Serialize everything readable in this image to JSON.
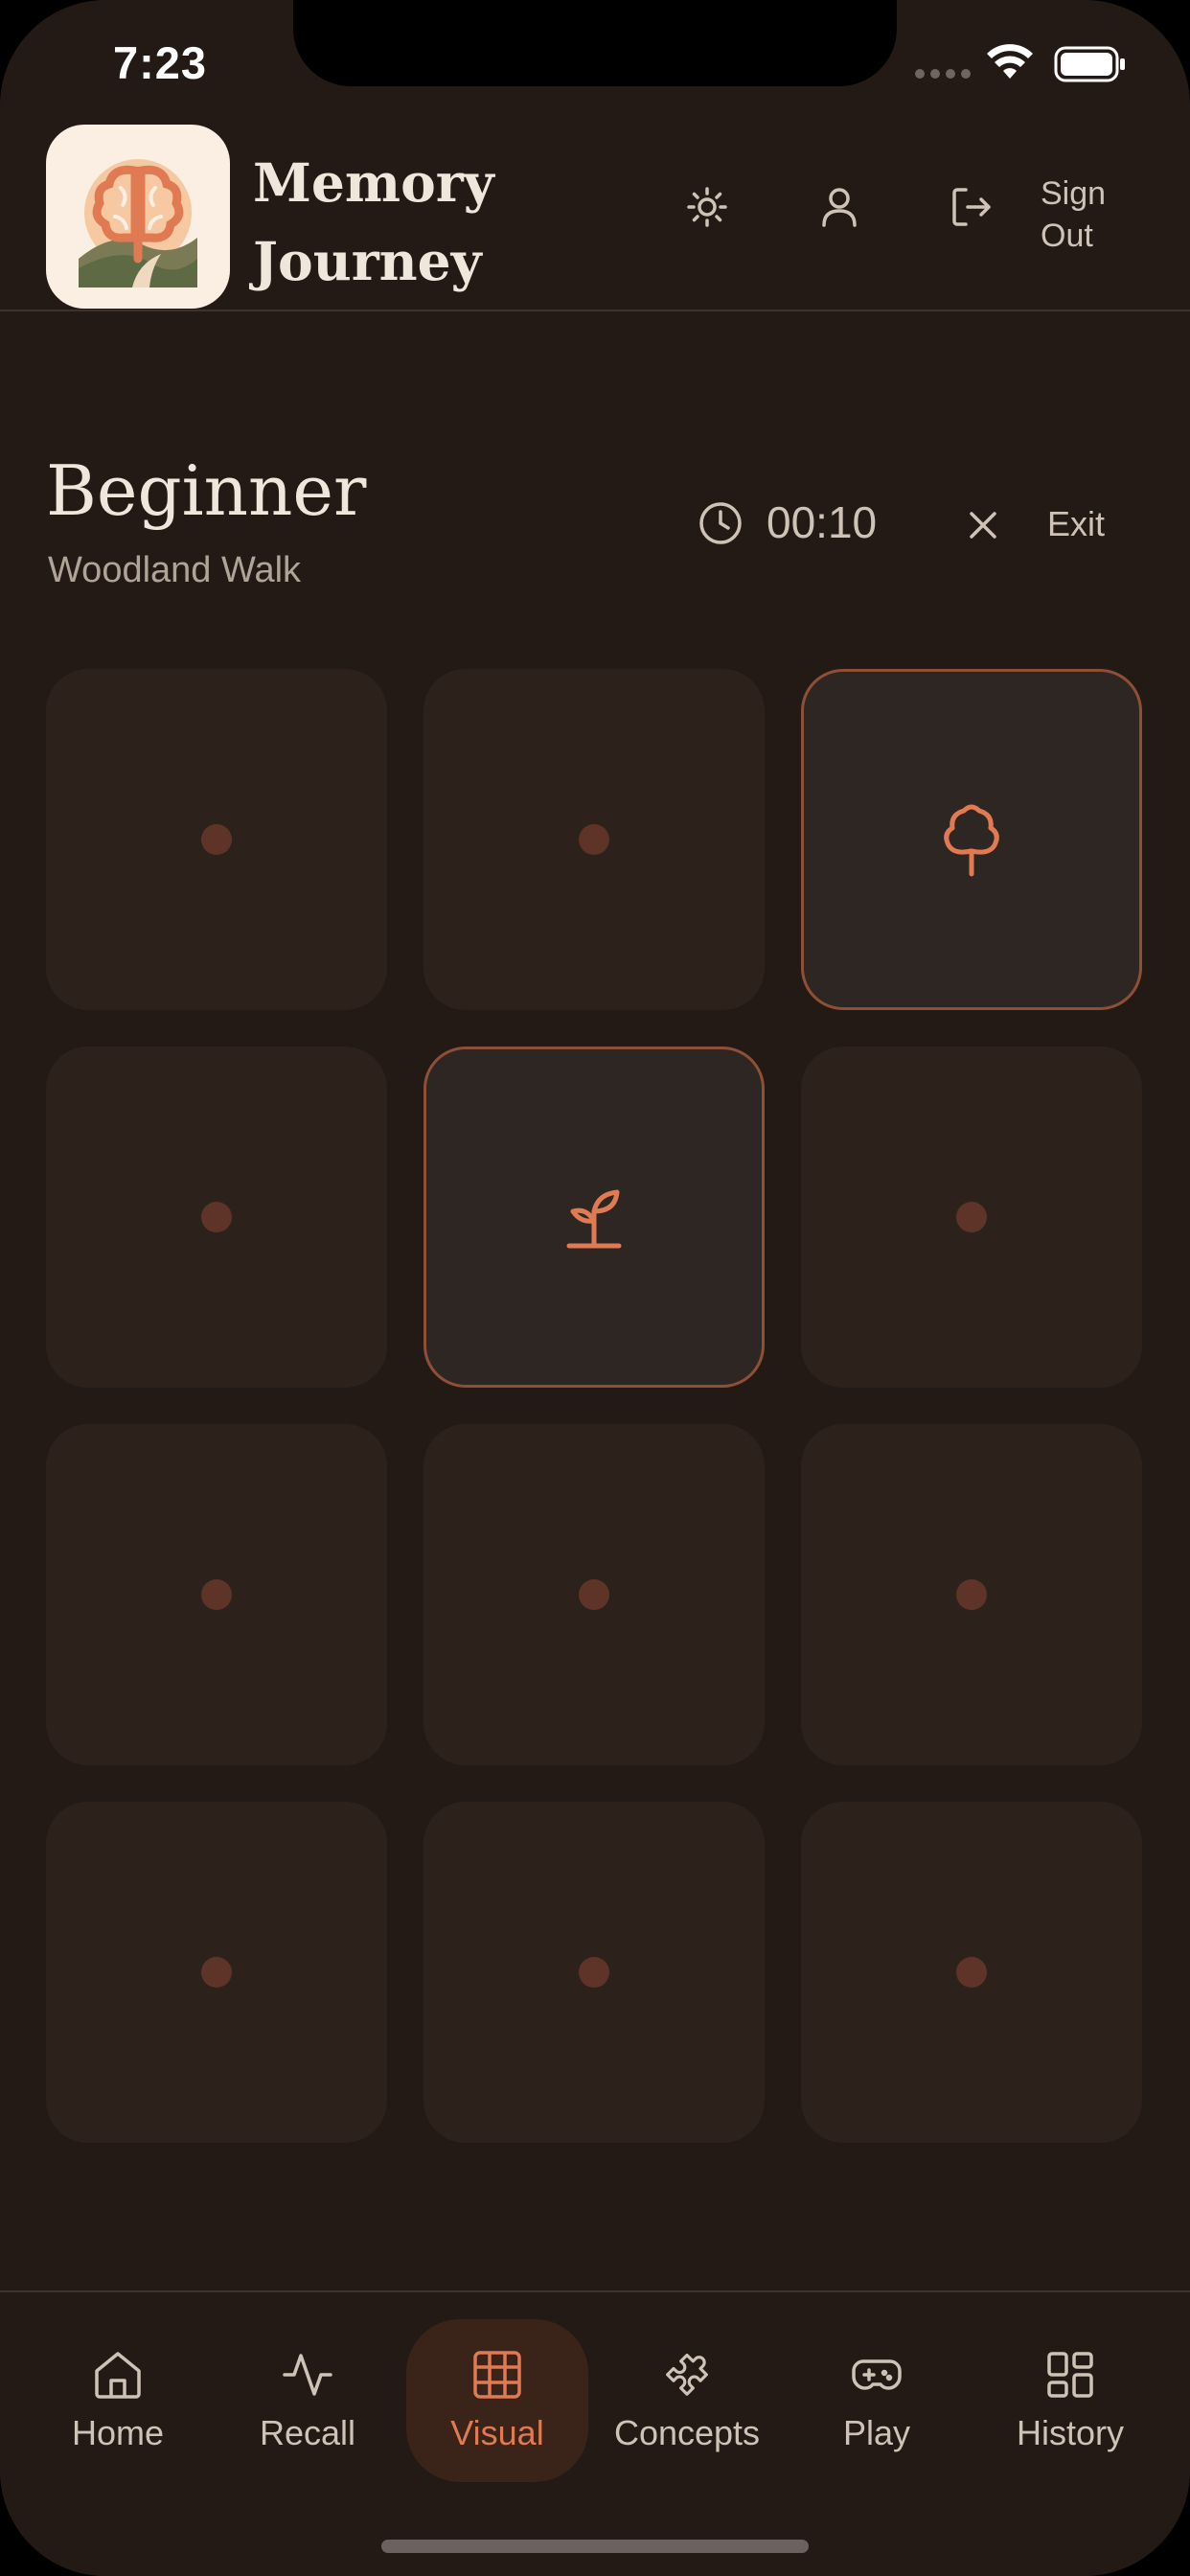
{
  "status_bar": {
    "time": "7:23"
  },
  "header": {
    "app_title_line1": "Memory",
    "app_title_line2": "Journey",
    "sign_out_line1": "Sign",
    "sign_out_line2": "Out",
    "icons": [
      "sun-icon",
      "user-icon",
      "logout-icon"
    ]
  },
  "game": {
    "level": "Beginner",
    "theme": "Woodland Walk",
    "timer": "00:10",
    "exit_label": "Exit",
    "tiles": [
      {
        "state": "hidden"
      },
      {
        "state": "hidden"
      },
      {
        "state": "revealed",
        "icon": "tree-icon"
      },
      {
        "state": "hidden"
      },
      {
        "state": "revealed",
        "icon": "sprout-icon"
      },
      {
        "state": "hidden"
      },
      {
        "state": "hidden"
      },
      {
        "state": "hidden"
      },
      {
        "state": "hidden"
      },
      {
        "state": "hidden"
      },
      {
        "state": "hidden"
      },
      {
        "state": "hidden"
      }
    ]
  },
  "nav": {
    "items": [
      {
        "label": "Home",
        "icon": "home-icon"
      },
      {
        "label": "Recall",
        "icon": "activity-icon"
      },
      {
        "label": "Visual",
        "icon": "grid-icon",
        "active": true
      },
      {
        "label": "Concepts",
        "icon": "puzzle-icon"
      },
      {
        "label": "Play",
        "icon": "gamepad-icon"
      },
      {
        "label": "History",
        "icon": "dashboard-icon"
      }
    ]
  },
  "colors": {
    "background": "#231a16",
    "accent": "#e07a52",
    "tile": "#2d211b",
    "tile_revealed": "#2e2623",
    "tile_border": "#8e4f37"
  }
}
